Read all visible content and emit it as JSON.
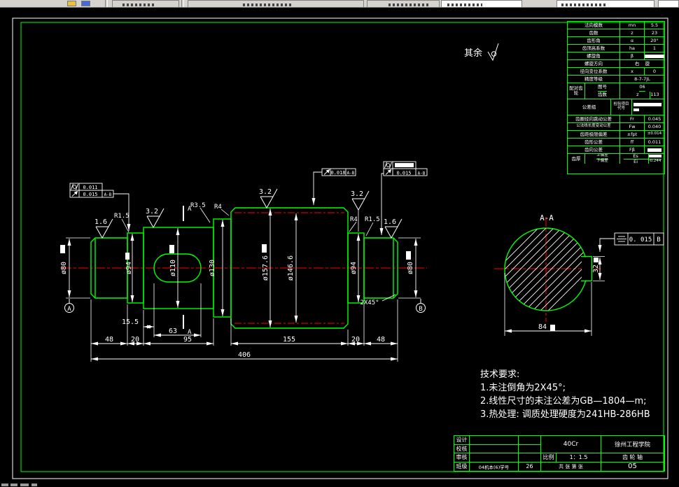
{
  "colors": {
    "line": "#00ff00",
    "centerline": "#ff0000",
    "annotation": "#ffffff",
    "toolbar": "#d6d3ce"
  },
  "sheet": {
    "rest_label": "其余"
  },
  "dims": {
    "len_15_5": "15.5",
    "len_63": "63",
    "len_48_left": "48",
    "len_20_left": "20",
    "len_95": "95",
    "len_155": "155",
    "len_20_right": "20",
    "len_48_right": "48",
    "len_total": "406",
    "dia_80_left": "ø80",
    "dia_94_left": "ø94",
    "dia_110": "ø110",
    "dia_130": "ø130",
    "dia_157_6": "ø157.6",
    "dia_146_6": "ø146.6",
    "dia_94_right": "ø94",
    "dia_80_right": "ø80",
    "chamfer": "2X45°",
    "sec_32": "32",
    "sec_84": "84",
    "section_title": "A-A"
  },
  "labels": {
    "rough_16_left": "1.6",
    "rough_32_a": "3.2",
    "rough_32_b": "3.2",
    "rough_32_c": "3.2",
    "rough_16_right": "1.6",
    "fillet_r15_left": "R1.5",
    "fillet_r35": "R3.5",
    "fillet_r4_left": "R4",
    "fillet_r4_right": "R4",
    "fillet_r15_right": "R1.5",
    "datum_a": "A",
    "datum_b": "B",
    "cut_a_top": "A",
    "cut_a_bottom": "A"
  },
  "fcf": {
    "left_cyl": "0.011",
    "left_runout": "0.015",
    "left_datum": "A-B",
    "mid_runout": "0.018",
    "mid_datum": "A-B",
    "right_runout": "0.015",
    "right_datum": "A-B",
    "sym_val": "0. 015",
    "sym_datum": "B"
  },
  "gear_table": {
    "r1": {
      "name": "法向模数",
      "sym": "mn",
      "val": "5.5"
    },
    "r2": {
      "name": "齿数",
      "sym": "z",
      "val": "23"
    },
    "r3": {
      "name": "齿形角",
      "sym": "α",
      "val": "20°"
    },
    "r4": {
      "name": "齿顶高系数",
      "sym": "ha",
      "val": "1"
    },
    "r5": {
      "name": "螺旋角",
      "sym": "β",
      "val": ""
    },
    "r6": {
      "name": "螺旋方向",
      "val": "右    旋"
    },
    "r7": {
      "name": "径向变位系数",
      "sym": "x",
      "val": "0"
    },
    "r8": {
      "name": "精度等级",
      "val": "8-7-7JL"
    },
    "r9": {
      "name": "配对齿轮",
      "sub1": "图号",
      "val1": "06",
      "sub2": "齿数",
      "sym2": "z",
      "val2": "113"
    },
    "r10": {
      "name": "公差组",
      "mid": "检验项目",
      "mid2": "代号",
      "val": ""
    },
    "r11": {
      "name": "齿圈径向跳动公差",
      "sym": "Fr",
      "val": "0.045"
    },
    "r12": {
      "name": "公法线长度变动公差",
      "sym": "Fw",
      "val": "0.040"
    },
    "r13": {
      "name": "齿距极限偏差",
      "sym": "±fpt",
      "val": "±0.014"
    },
    "r14": {
      "name": "齿形公差",
      "sym": "ff",
      "val": "0.011"
    },
    "r15": {
      "name": "齿向公差",
      "sym": "Fβ",
      "val": ""
    },
    "r16": {
      "name": "齿厚",
      "sub1": "上偏差",
      "sym1": "Es",
      "val1": "",
      "sub2": "下偏差",
      "sym2": "Ei",
      "val2": "-0.244"
    }
  },
  "tech_req": {
    "title": "技术要求:",
    "item1": "1.未注倒角为2X45°;",
    "item2": "2.线性尺寸的未注公差为GB—1804—m;",
    "item3": "3.热处理: 调质处理硬度为241HB-286HB"
  },
  "title_block": {
    "design": "设计",
    "check": "校核",
    "audit": "审核",
    "class_label": "班级",
    "class_value": "04机本(6)学号",
    "number": "26",
    "material": "40Cr",
    "school": "徐州工程学院",
    "scale_label": "比例",
    "scale": "1：1.5",
    "sheets": "共    张 第    张",
    "part": "齿 轮 轴",
    "drawing_no": "05"
  }
}
